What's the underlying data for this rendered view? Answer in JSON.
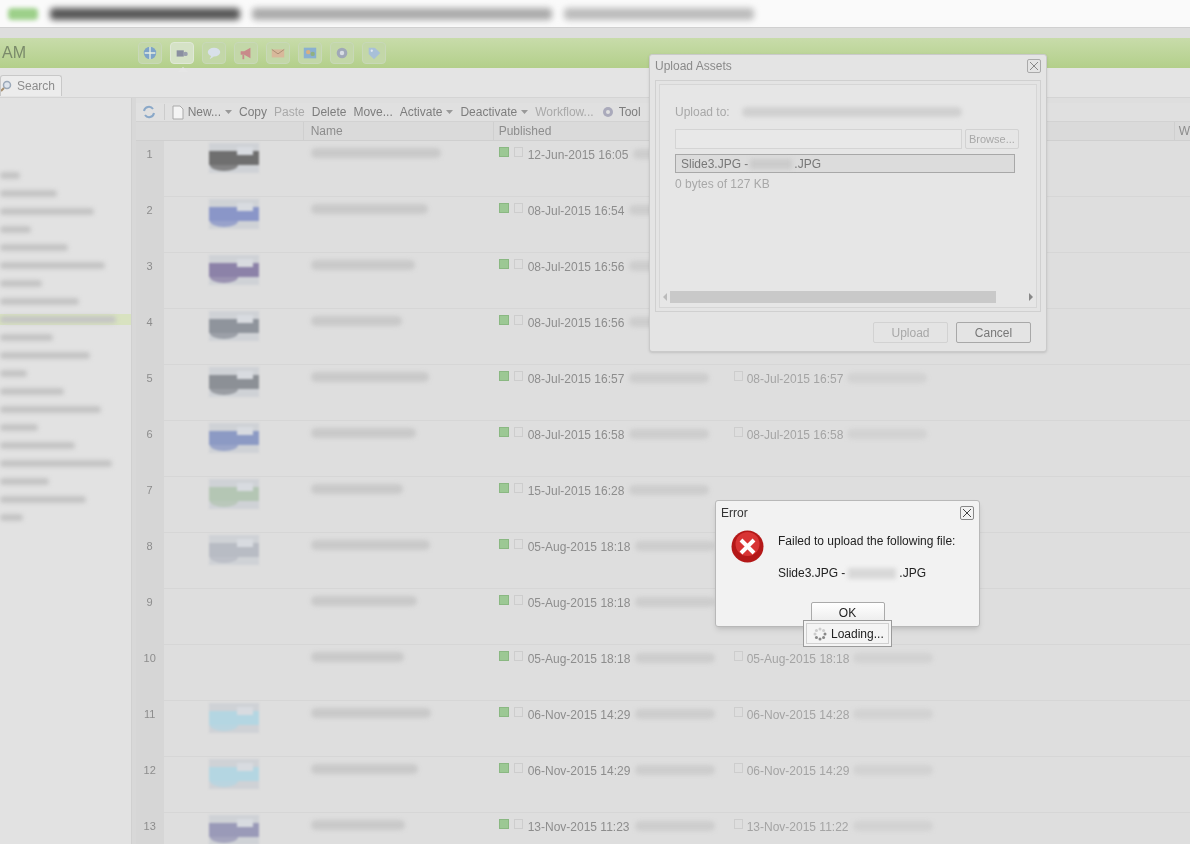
{
  "header": {
    "app_title": "AM",
    "nav_items": [
      {
        "selected": false
      },
      {
        "selected": true
      },
      {
        "selected": false
      },
      {
        "selected": false
      },
      {
        "selected": false
      },
      {
        "selected": false
      },
      {
        "selected": false
      },
      {
        "selected": false
      }
    ]
  },
  "tabs": [
    {
      "label": "Search",
      "selected": true
    }
  ],
  "sidebar": {
    "items": [
      {
        "selected": false
      },
      {
        "selected": false
      },
      {
        "selected": false
      },
      {
        "selected": false
      },
      {
        "selected": false
      },
      {
        "selected": false
      },
      {
        "selected": false
      },
      {
        "selected": false
      },
      {
        "selected": true
      },
      {
        "selected": false
      },
      {
        "selected": false
      },
      {
        "selected": false
      },
      {
        "selected": false
      },
      {
        "selected": false
      },
      {
        "selected": false
      },
      {
        "selected": false
      },
      {
        "selected": false
      },
      {
        "selected": false
      },
      {
        "selected": false
      },
      {
        "selected": false
      }
    ]
  },
  "toolbar": {
    "items": [
      {
        "label": "New...",
        "kind": "menu",
        "disabled": false
      },
      {
        "label": "Copy",
        "kind": "button",
        "disabled": false
      },
      {
        "label": "Paste",
        "kind": "button",
        "disabled": true
      },
      {
        "label": "Delete",
        "kind": "button",
        "disabled": false
      },
      {
        "label": "Move...",
        "kind": "button",
        "disabled": false
      },
      {
        "label": "Activate",
        "kind": "menu",
        "disabled": false
      },
      {
        "label": "Deactivate",
        "kind": "menu",
        "disabled": false
      },
      {
        "label": "Workflow...",
        "kind": "button",
        "disabled": true
      },
      {
        "label": "Tool",
        "kind": "tools",
        "disabled": false
      }
    ]
  },
  "table": {
    "columns": [
      "Name",
      "Published",
      "W"
    ],
    "rows": [
      {
        "number": "1",
        "published": "12-Jun-2015 16:05",
        "thumbnail": true
      },
      {
        "number": "2",
        "published": "08-Jul-2015 16:54",
        "thumbnail": true
      },
      {
        "number": "3",
        "published": "08-Jul-2015 16:56",
        "thumbnail": true
      },
      {
        "number": "4",
        "published": "08-Jul-2015 16:56",
        "thumbnail": true
      },
      {
        "number": "5",
        "published": "08-Jul-2015 16:57",
        "modified": "08-Jul-2015 16:57",
        "thumbnail": true
      },
      {
        "number": "6",
        "published": "08-Jul-2015 16:58",
        "modified": "08-Jul-2015 16:58",
        "thumbnail": true
      },
      {
        "number": "7",
        "published": "15-Jul-2015 16:28",
        "thumbnail": true
      },
      {
        "number": "8",
        "published": "05-Aug-2015 18:18",
        "thumbnail": true
      },
      {
        "number": "9",
        "published": "05-Aug-2015 18:18",
        "thumbnail": false
      },
      {
        "number": "10",
        "published": "05-Aug-2015 18:18",
        "modified": "05-Aug-2015 18:18",
        "thumbnail": false
      },
      {
        "number": "11",
        "published": "06-Nov-2015 14:29",
        "modified": "06-Nov-2015 14:28",
        "thumbnail": true
      },
      {
        "number": "12",
        "published": "06-Nov-2015 14:29",
        "modified": "06-Nov-2015 14:29",
        "thumbnail": true
      },
      {
        "number": "13",
        "published": "13-Nov-2015 11:23",
        "modified": "13-Nov-2015 11:22",
        "thumbnail": true
      }
    ]
  },
  "upload_dialog": {
    "title": "Upload Assets",
    "upload_to_label": "Upload to:",
    "browse_button": "Browse...",
    "file_prefix": "Slide3.JPG -",
    "file_suffix": ".JPG",
    "progress": "0 bytes of 127 KB",
    "buttons": [
      {
        "label": "Upload",
        "disabled": true
      },
      {
        "label": "Cancel",
        "disabled": false
      }
    ]
  },
  "error_dialog": {
    "title": "Error",
    "message": "Failed to upload the following file:",
    "file_prefix": "Slide3.JPG -",
    "file_suffix": ".JPG",
    "button": "OK"
  },
  "loading": {
    "label": "Loading..."
  }
}
